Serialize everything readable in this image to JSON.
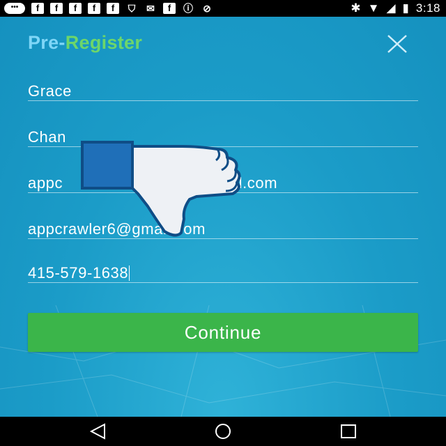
{
  "status_bar": {
    "time": "3:18",
    "icons": [
      "messages-icon",
      "facebook-icon",
      "facebook-icon",
      "facebook-icon",
      "facebook-icon",
      "facebook-icon",
      "shield-icon",
      "mail-icon",
      "facebook-icon",
      "info-icon",
      "no-sim-icon"
    ],
    "right_icons": [
      "bluetooth-icon",
      "wifi-icon",
      "signal-icon",
      "battery-icon"
    ]
  },
  "header": {
    "title_part1": "Pre-",
    "title_part2": "Register",
    "title_color1": "#7fd6f7",
    "title_color2": "#6dd66a"
  },
  "form": {
    "first_name": "Grace",
    "last_name": "Chan",
    "email": "appcrawler6@gmail.com",
    "email_visible_left": "appc",
    "email_visible_right": "il.com",
    "confirm_email": "appcrawler6@gmail.com",
    "phone": "415-579-1638"
  },
  "continue_button": {
    "label": "Continue",
    "color": "#3bb54a"
  },
  "overlay": {
    "icon": "thumbs-down-icon"
  },
  "nav_bar": {
    "buttons": [
      "back-icon",
      "home-icon",
      "recents-icon"
    ]
  }
}
